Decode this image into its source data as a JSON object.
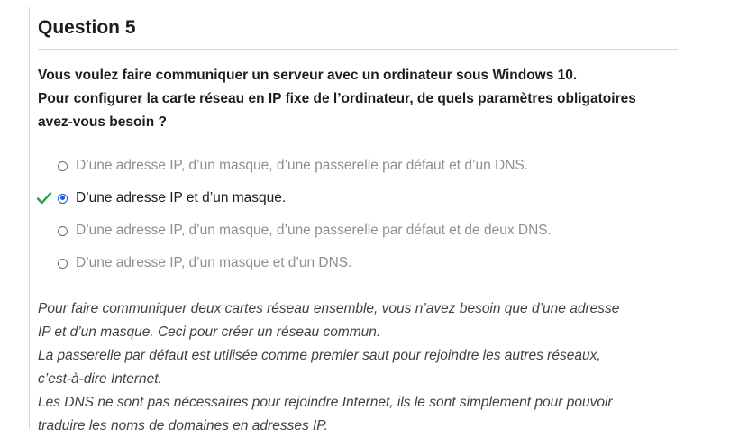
{
  "question": {
    "title": "Question 5",
    "prompt": [
      "Vous voulez faire communiquer un serveur avec un ordinateur sous Windows 10.",
      "Pour configurer la carte réseau en IP fixe de l’ordinateur, de quels paramètres obligatoires",
      "avez-vous besoin ?"
    ],
    "answers": [
      {
        "label": "D’une adresse IP, d’un masque, d’une passerelle par défaut et d’un DNS.",
        "selected": false,
        "correct": false
      },
      {
        "label": "D’une adresse IP et d’un masque.",
        "selected": true,
        "correct": true
      },
      {
        "label": "D’une adresse IP, d’un masque, d’une passerelle par défaut et de deux DNS.",
        "selected": false,
        "correct": false
      },
      {
        "label": "D’une adresse IP, d’un masque et d’un DNS.",
        "selected": false,
        "correct": false
      }
    ],
    "explanation": [
      "Pour faire communiquer deux cartes réseau ensemble, vous n’avez besoin que d’une adresse",
      "IP et d’un masque. Ceci pour créer un réseau commun.",
      "La passerelle par défaut est utilisée comme premier saut pour rejoindre les autres réseaux,",
      "c’est-à-dire Internet.",
      "Les DNS ne sont pas nécessaires pour rejoindre Internet, ils le sont simplement pour pouvoir",
      "traduire les noms de domaines en adresses IP."
    ]
  },
  "colors": {
    "check": "#1e9e4a",
    "radio_selected": "#1c5bd9",
    "unselected_text": "#8a8f93"
  },
  "icons": {
    "correct": "checkmark-icon",
    "radio": "radio-button-icon"
  }
}
